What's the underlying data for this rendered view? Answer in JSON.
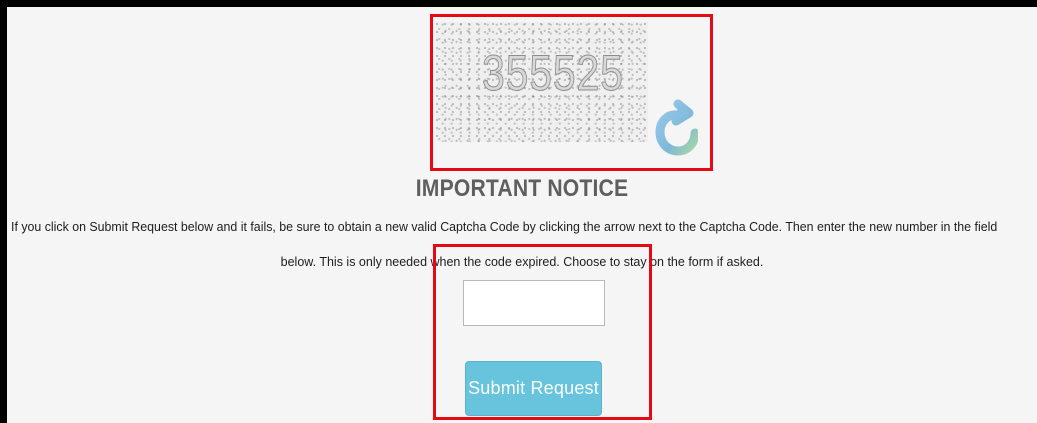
{
  "captcha": {
    "code": "355525",
    "icon": "refresh-icon"
  },
  "notice": {
    "title": "IMPORTANT NOTICE",
    "line_1": "If you click on Submit Request below and it fails, be sure to obtain a new valid Captcha Code by clicking the arrow next to the Captcha Code. Then enter the new number in the field",
    "line_2": "below. This is only needed when the code expired. Choose to stay on the form if asked."
  },
  "form": {
    "input_value": "",
    "input_placeholder": "",
    "submit_label": "Submit Request"
  },
  "colors": {
    "highlight": "#e50914",
    "button": "#67c4dc",
    "background": "#f5f5f5"
  }
}
